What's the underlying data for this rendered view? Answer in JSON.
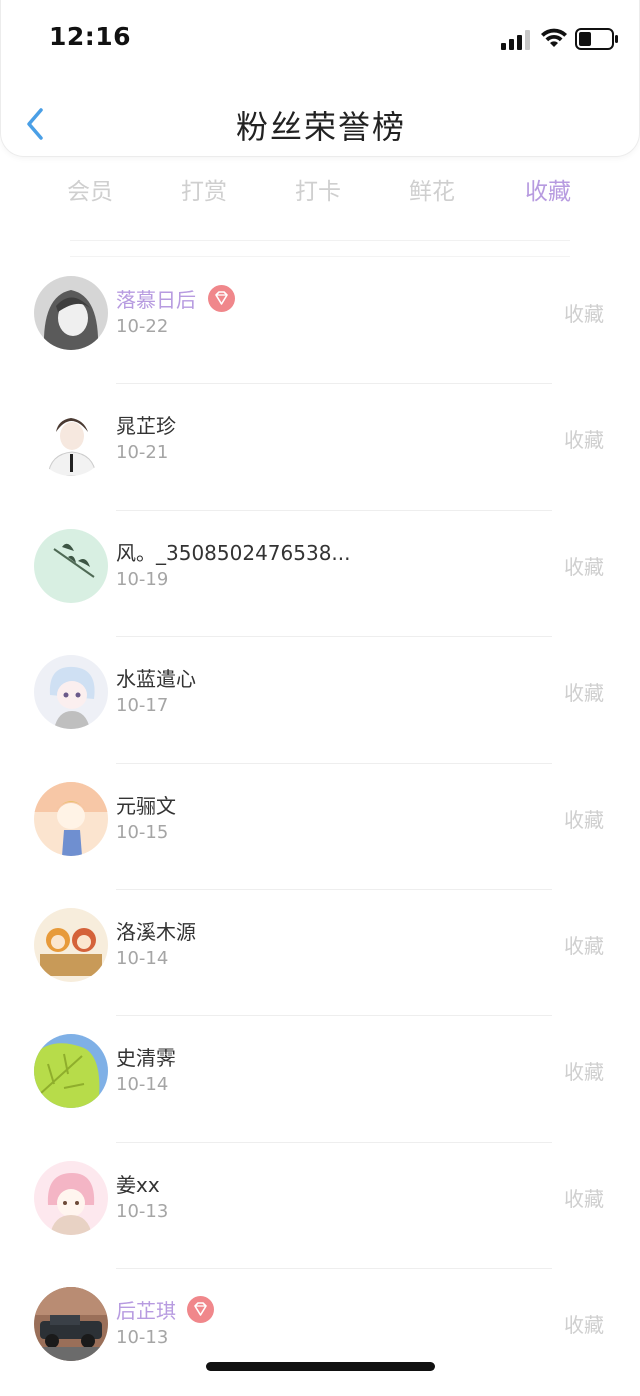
{
  "status_bar": {
    "time": "12:16"
  },
  "header": {
    "title": "粉丝荣誉榜"
  },
  "tabs": [
    {
      "label": "会员",
      "active": false
    },
    {
      "label": "打赏",
      "active": false
    },
    {
      "label": "打卡",
      "active": false
    },
    {
      "label": "鲜花",
      "active": false
    },
    {
      "label": "收藏",
      "active": true
    }
  ],
  "accent_color": "#b79be0",
  "list": [
    {
      "name": "落慕日后",
      "vip": true,
      "date": "10-22",
      "action": "收藏"
    },
    {
      "name": "晁芷珍",
      "vip": false,
      "date": "10-21",
      "action": "收藏"
    },
    {
      "name": "风。_3508502476538...",
      "vip": false,
      "date": "10-19",
      "action": "收藏"
    },
    {
      "name": "水蓝遣心",
      "vip": false,
      "date": "10-17",
      "action": "收藏"
    },
    {
      "name": "元骊文",
      "vip": false,
      "date": "10-15",
      "action": "收藏"
    },
    {
      "name": "洛溪木源",
      "vip": false,
      "date": "10-14",
      "action": "收藏"
    },
    {
      "name": "史清霁",
      "vip": false,
      "date": "10-14",
      "action": "收藏"
    },
    {
      "name": "姜xx",
      "vip": false,
      "date": "10-13",
      "action": "收藏"
    },
    {
      "name": "后芷琪",
      "vip": true,
      "date": "10-13",
      "action": "收藏"
    }
  ]
}
